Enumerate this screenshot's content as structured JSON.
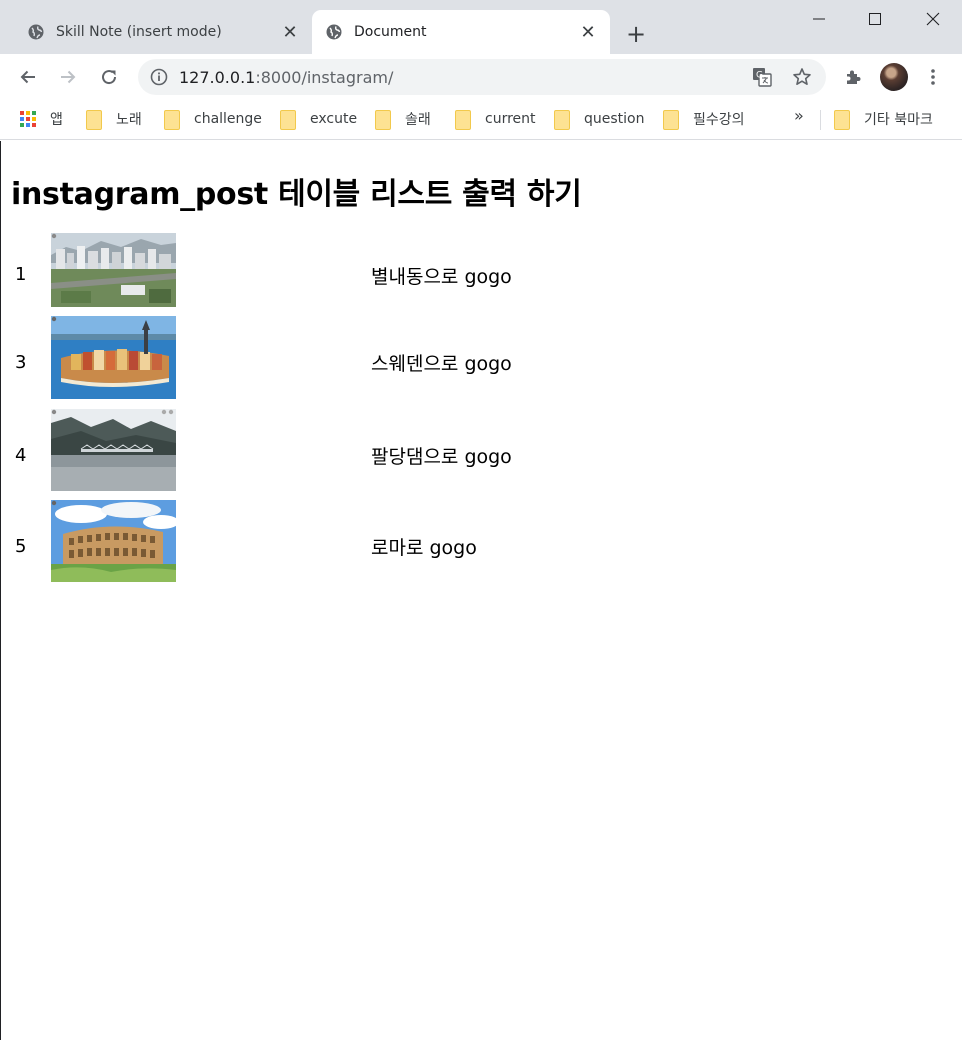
{
  "window": {
    "tabs": [
      {
        "title": "Skill Note (insert mode)",
        "active": false,
        "favicon": "globe-icon"
      },
      {
        "title": "Document",
        "active": true,
        "favicon": "globe-icon"
      }
    ],
    "new_tab_icon": "plus-icon",
    "controls": [
      "minimize-icon",
      "maximize-icon",
      "close-icon"
    ]
  },
  "toolbar": {
    "url_host": "127.0.0.1",
    "url_path": ":8000/instagram/",
    "buttons": [
      "back-arrow-icon",
      "forward-arrow-icon",
      "reload-icon",
      "info-icon",
      "translate-icon",
      "star-icon",
      "extensions-icon",
      "avatar",
      "kebab-menu-icon"
    ]
  },
  "bookmarks": {
    "apps_label": "앱",
    "items": [
      "노래",
      "challenge",
      "excute",
      "솔래",
      "current",
      "question",
      "필수강의"
    ],
    "more": "»",
    "other": "기타 북마크",
    "colors": {
      "folder": "#fde293",
      "apps": [
        "#ea4335",
        "#fbbc04",
        "#34a853",
        "#4285f4"
      ]
    }
  },
  "page": {
    "title": "instagram_post 테이블 리스트 출력 하기",
    "posts": [
      {
        "id": "1",
        "caption": "별내동으로 gogo",
        "image": "city-skyline-photo"
      },
      {
        "id": "3",
        "caption": "스웨덴으로 gogo",
        "image": "stockholm-old-town-photo"
      },
      {
        "id": "4",
        "caption": "팔당댐으로 gogo",
        "image": "paldang-dam-photo"
      },
      {
        "id": "5",
        "caption": "로마로 gogo",
        "image": "colosseum-photo"
      }
    ]
  }
}
